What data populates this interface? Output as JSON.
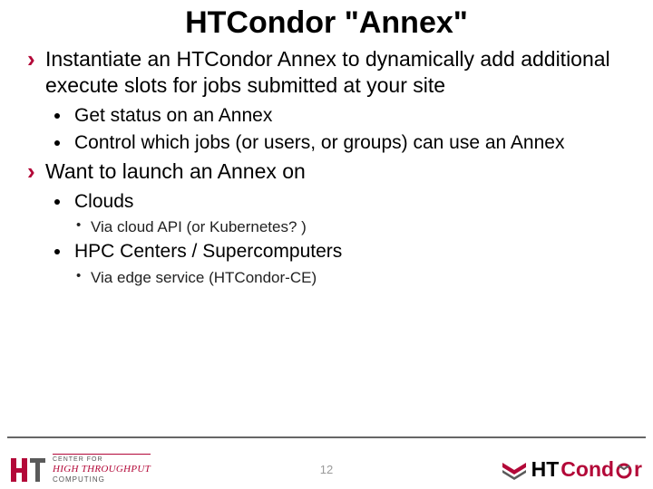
{
  "title": "HTCondor \"Annex\"",
  "bullets": {
    "b1": "Instantiate an HTCondor Annex to dynamically add additional execute slots for jobs submitted at your site",
    "b1a": "Get status on an Annex",
    "b1b": "Control which jobs (or users, or groups) can use an Annex",
    "b2": "Want to launch an Annex on",
    "b2a": "Clouds",
    "b2a1": "Via cloud API  (or Kubernetes? )",
    "b2b": "HPC  Centers / Supercomputers",
    "b2b1": "Via edge service (HTCondor-CE)"
  },
  "footer": {
    "page": "12",
    "left_logo": {
      "line1": "CENTER FOR",
      "line2": "HIGH THROUGHPUT",
      "line3": "COMPUTING"
    },
    "right_logo": {
      "part1": "HT",
      "part2": "Cond",
      "part3": "r"
    }
  }
}
